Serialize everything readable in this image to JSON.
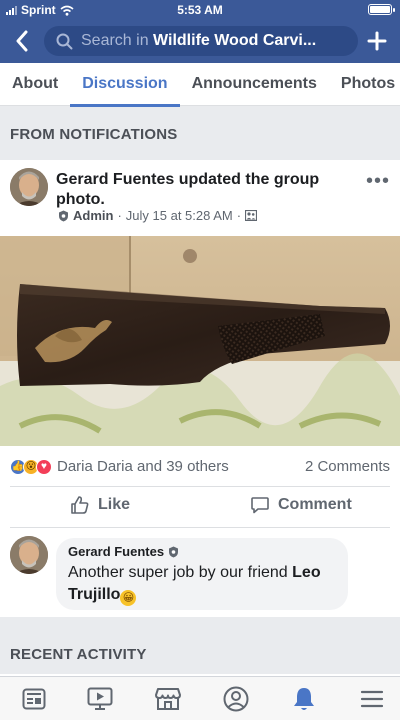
{
  "status_bar": {
    "carrier": "Sprint",
    "time": "5:53 AM"
  },
  "header": {
    "search_prefix": "Search in",
    "search_group": "Wildlife Wood Carvi..."
  },
  "tabs": [
    {
      "label": "About",
      "active": false
    },
    {
      "label": "Discussion",
      "active": true
    },
    {
      "label": "Announcements",
      "active": false
    },
    {
      "label": "Photos",
      "active": false
    }
  ],
  "sections": {
    "notifications_title": "FROM NOTIFICATIONS",
    "recent_title": "RECENT ACTIVITY"
  },
  "post": {
    "author": "Gerard Fuentes",
    "action": " updated the group photo.",
    "role": "Admin",
    "date": "July 15 at 5:28 AM",
    "reactions_text": "Daria Daria and 39 others",
    "comments_count": "2 Comments",
    "like_label": "Like",
    "comment_label": "Comment"
  },
  "comment": {
    "author": "Gerard Fuentes",
    "text": "Another super job by our friend ",
    "mention": "Leo Trujillo",
    "emoji": "😀"
  },
  "icons": {
    "back": "chevron-left-icon",
    "search": "search-icon",
    "add": "plus-icon",
    "nav": [
      "news-feed-icon",
      "watch-icon",
      "marketplace-icon",
      "profile-icon",
      "notifications-icon",
      "menu-icon"
    ]
  },
  "colors": {
    "brand": "#3b5998",
    "accent": "#4a76c6",
    "background": "#e9ebee"
  }
}
